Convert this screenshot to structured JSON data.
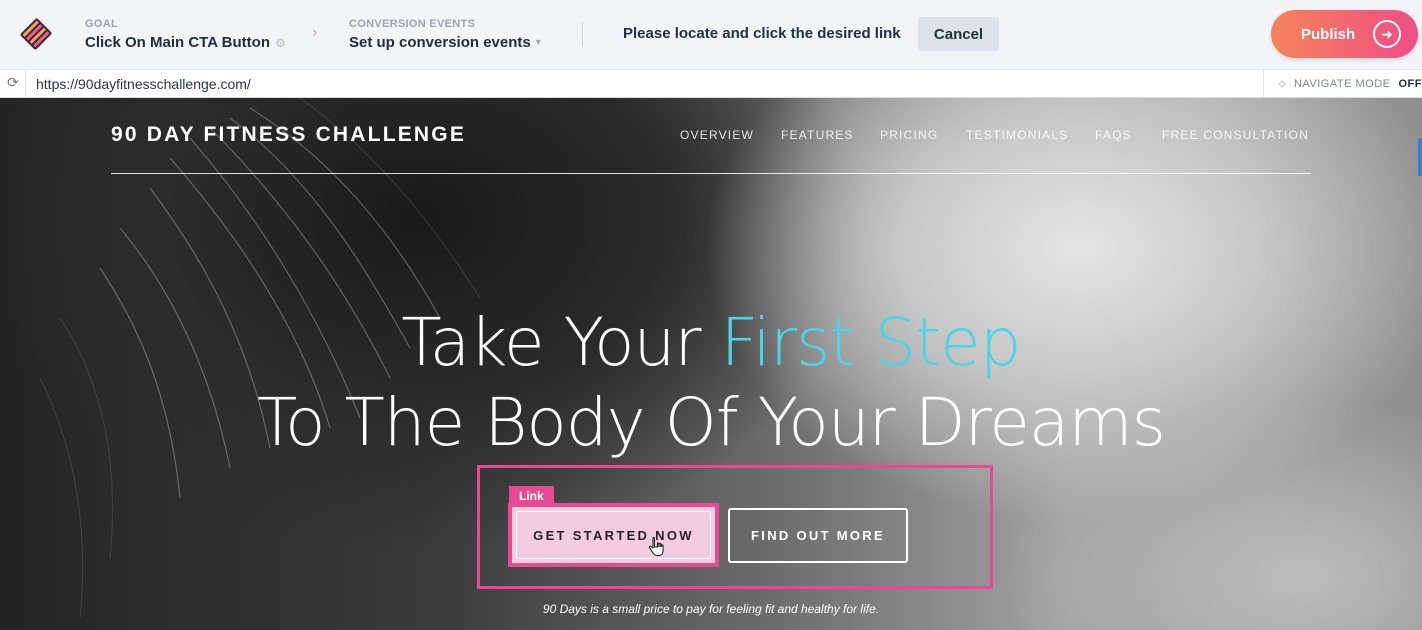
{
  "editor": {
    "goal_label": "GOAL",
    "goal_value": "Click On Main CTA Button",
    "conversion_label": "CONVERSION EVENTS",
    "conversion_value": "Set up conversion events",
    "prompt": "Please locate and click the desired link",
    "cancel_label": "Cancel",
    "publish_label": "Publish",
    "icons": [
      "app-logo-icon",
      "gear-icon",
      "chevron-right-icon",
      "chevron-down-icon",
      "arrow-right-icon"
    ],
    "publish_gradient": [
      "#f6845a",
      "#ee4d88"
    ]
  },
  "urlbar": {
    "url": "https://90dayfitnesschallenge.com/",
    "navigate_mode_label": "NAVIGATE MODE",
    "navigate_mode_state": "OFF",
    "icons": [
      "refresh-icon",
      "crosshair-icon"
    ]
  },
  "site": {
    "brand": "90 DAY FITNESS CHALLENGE",
    "nav": [
      "OVERVIEW",
      "FEATURES",
      "PRICING",
      "TESTIMONIALS",
      "FAQS",
      "FREE CONSULTATION"
    ],
    "headline_part1": "Take Your ",
    "headline_accent": "First Step",
    "headline_line2": "To The Body Of Your Dreams",
    "accent_color": "#4fd3e6",
    "cta_primary": "GET STARTED NOW",
    "cta_secondary": "FIND OUT MORE",
    "tagline": "90 Days is a small price to pay for feeling fit and healthy for life."
  },
  "selection": {
    "tag_label": "Link",
    "highlight_color": "#e44b93"
  }
}
